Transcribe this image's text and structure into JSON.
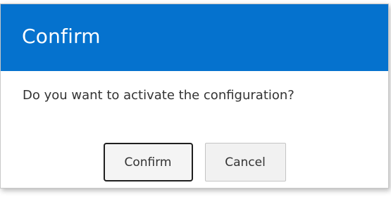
{
  "dialog": {
    "title": "Confirm",
    "message": "Do you want to activate the configuration?",
    "buttons": {
      "confirm_label": "Confirm",
      "cancel_label": "Cancel"
    }
  },
  "colors": {
    "header_background": "#0572ce",
    "header_text": "#ffffff",
    "button_background": "#f1f1f1",
    "focused_button_border": "#1f1f1f"
  }
}
